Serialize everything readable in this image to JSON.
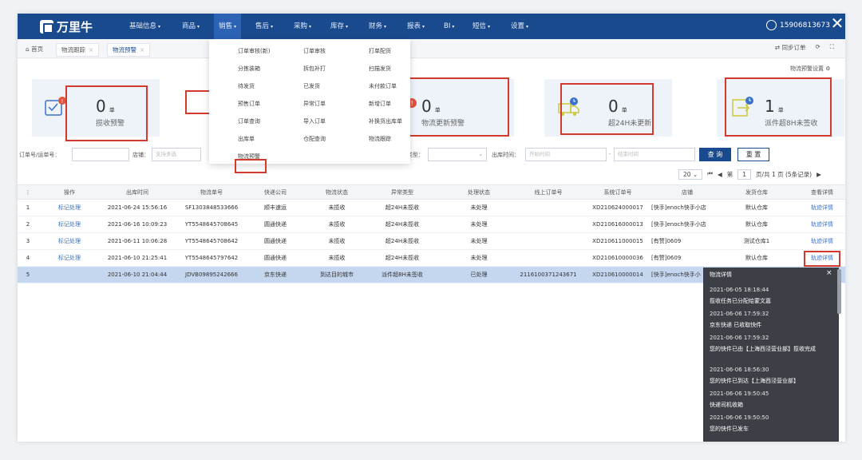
{
  "app": {
    "logo": "万里牛"
  },
  "nav": {
    "items": [
      "基础信息",
      "商品",
      "销售",
      "售后",
      "采购",
      "库存",
      "财务",
      "报表",
      "BI",
      "短信",
      "设置"
    ],
    "caret": "▾",
    "user": "15906813673",
    "close": "✕"
  },
  "tabs": {
    "home": "首页",
    "items": [
      "物流跟踪",
      "物流预警"
    ],
    "close": "×",
    "right": [
      "同步订单",
      "⟳",
      "⛶"
    ]
  },
  "dropdown": {
    "col1": [
      "订单审核(新)",
      "分拣装箱",
      "待发货",
      "预售订单",
      "订单查询",
      "出库单",
      "物流预警"
    ],
    "col2": [
      "订单审核",
      "拆包补打",
      "已发货",
      "异常订单",
      "导入订单",
      "仓配查询"
    ],
    "col3": [
      "打单配货",
      "扫描发货",
      "未付款订单",
      "新增订单",
      "补换货出库单",
      "物流跟踪"
    ]
  },
  "settings_link": "物流预警设置",
  "cards": [
    {
      "value": "0",
      "unit": "单",
      "label": "揽收预警"
    },
    {
      "value": "0",
      "unit": "单",
      "label": "物流更新预警"
    },
    {
      "value": "0",
      "unit": "单",
      "label": "超24H未更新"
    },
    {
      "value": "1",
      "unit": "单",
      "label": "派件超8H未签收"
    }
  ],
  "filter": {
    "order_label": "订单号/运单号：",
    "shop_label": "店铺：",
    "shop_placeholder": "支持多选",
    "type_label": "类型：",
    "out_time_label": "出库时间：",
    "start_placeholder": "开始时间",
    "dash": "-",
    "end_placeholder": "结束时间",
    "search": "查 询",
    "reset": "重 置"
  },
  "pager": {
    "page_size": "20",
    "page": "1",
    "page_word": "第",
    "info": "页/共 1 页 (5条记录)"
  },
  "table": {
    "headers": [
      "⋮",
      "操作",
      "出库时间",
      "物流单号",
      "快递公司",
      "物流状态",
      "异常类型",
      "处理状态",
      "线上订单号",
      "系统订单号",
      "店铺",
      "发货仓库",
      "查看详情"
    ],
    "rows": [
      [
        "1",
        "标记处理",
        "2021-06-24 15:56:16",
        "SF1303848533666",
        "顺丰速运",
        "未揽收",
        "超24H未揽收",
        "未处理",
        "",
        "XD210624000017",
        "[快手]enoch快手小店",
        "默认仓库",
        "轨迹详情"
      ],
      [
        "2",
        "标记处理",
        "2021-06-16 10:09:23",
        "YT5548645708645",
        "圆通快递",
        "未揽收",
        "超24H未揽收",
        "未处理",
        "",
        "XD210616000013",
        "[快手]enoch快手小店",
        "默认仓库",
        "轨迹详情"
      ],
      [
        "3",
        "标记处理",
        "2021-06-11 10:06:28",
        "YT5548645708642",
        "圆通快递",
        "未揽收",
        "超24H未揽收",
        "未处理",
        "",
        "XD210611000015",
        "[有赞]0609",
        "测试仓库1",
        "轨迹详情"
      ],
      [
        "4",
        "标记处理",
        "2021-06-10 21:25:41",
        "YT5548645797642",
        "圆通快递",
        "未揽收",
        "超24H未揽收",
        "未处理",
        "",
        "XD210610000036",
        "[有赞]0609",
        "默认仓库",
        "轨迹详情"
      ],
      [
        "5",
        "",
        "2021-06-10 21:04:44",
        "JDVB09895242666",
        "京东快递",
        "到达目的城市",
        "派件超8H未签收",
        "已处理",
        "2116100371243671",
        "XD210610000014",
        "[快手]enoch快手小",
        "",
        ""
      ]
    ]
  },
  "popup": {
    "title": "物流详情",
    "close": "×",
    "events": [
      {
        "time": "2021-06-05 18:18:44",
        "msg": "揽收任务已分配给蒙文嘉"
      },
      {
        "time": "2021-06-06 17:59:32",
        "msg": "京东快递 已收取快件"
      },
      {
        "time": "2021-06-06 17:59:32",
        "msg": "您的快件已由【上海西泾营业部】揽收完成"
      },
      {
        "time": "2021-06-06 18:56:30",
        "msg": "您的快件已到达【上海西泾营业部】"
      },
      {
        "time": "2021-06-06 19:50:45",
        "msg": "快递司机收箱"
      },
      {
        "time": "2021-06-06 19:50:50",
        "msg": "您的快件已发车"
      }
    ]
  }
}
